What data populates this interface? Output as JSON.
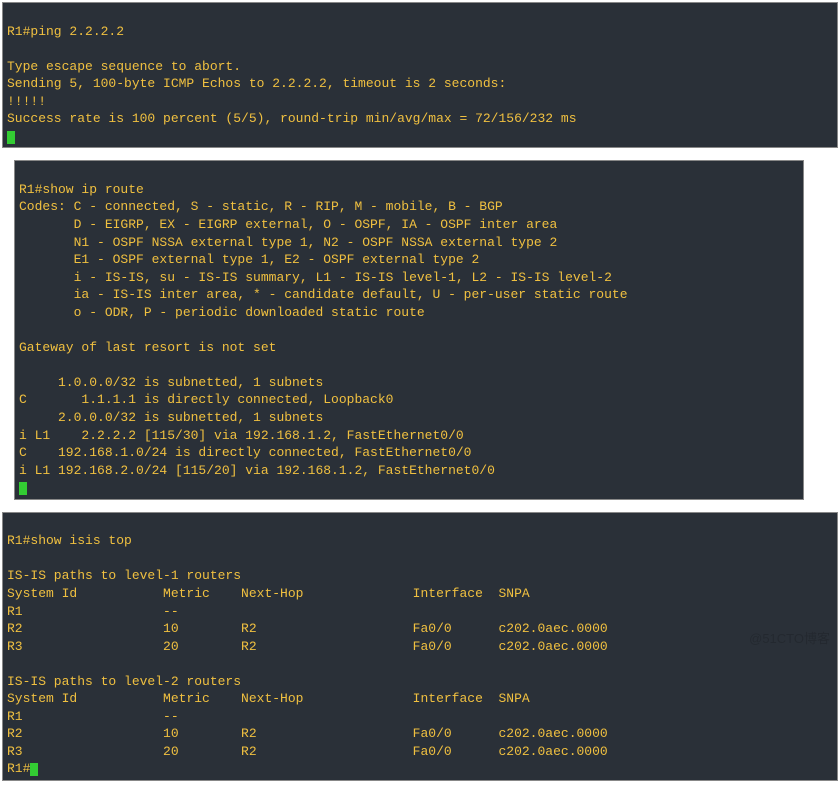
{
  "terminal1": {
    "cmd": "R1#ping 2.2.2.2",
    "lines": [
      "",
      "Type escape sequence to abort.",
      "Sending 5, 100-byte ICMP Echos to 2.2.2.2, timeout is 2 seconds:",
      "!!!!!",
      "Success rate is 100 percent (5/5), round-trip min/avg/max = 72/156/232 ms"
    ]
  },
  "terminal2": {
    "cmd": "R1#show ip route",
    "codes": [
      "Codes: C - connected, S - static, R - RIP, M - mobile, B - BGP",
      "       D - EIGRP, EX - EIGRP external, O - OSPF, IA - OSPF inter area ",
      "       N1 - OSPF NSSA external type 1, N2 - OSPF NSSA external type 2",
      "       E1 - OSPF external type 1, E2 - OSPF external type 2",
      "       i - IS-IS, su - IS-IS summary, L1 - IS-IS level-1, L2 - IS-IS level-2",
      "       ia - IS-IS inter area, * - candidate default, U - per-user static route",
      "       o - ODR, P - periodic downloaded static route"
    ],
    "gateway": "Gateway of last resort is not set",
    "routes": [
      "     1.0.0.0/32 is subnetted, 1 subnets",
      "C       1.1.1.1 is directly connected, Loopback0",
      "     2.0.0.0/32 is subnetted, 1 subnets",
      "i L1    2.2.2.2 [115/30] via 192.168.1.2, FastEthernet0/0",
      "C    192.168.1.0/24 is directly connected, FastEthernet0/0",
      "i L1 192.168.2.0/24 [115/20] via 192.168.1.2, FastEthernet0/0"
    ]
  },
  "terminal3": {
    "cmd": "R1#show isis top",
    "l1_header": "IS-IS paths to level-1 routers",
    "cols": {
      "sysid": "System Id",
      "metric": "Metric",
      "nexthop": "Next-Hop",
      "interface": "Interface",
      "snpa": "SNPA"
    },
    "l1_rows": [
      {
        "sysid": "R1",
        "metric": "--",
        "nexthop": "",
        "interface": "",
        "snpa": ""
      },
      {
        "sysid": "R2",
        "metric": "10",
        "nexthop": "R2",
        "interface": "Fa0/0",
        "snpa": "c202.0aec.0000"
      },
      {
        "sysid": "R3",
        "metric": "20",
        "nexthop": "R2",
        "interface": "Fa0/0",
        "snpa": "c202.0aec.0000"
      }
    ],
    "l2_header": "IS-IS paths to level-2 routers",
    "l2_rows": [
      {
        "sysid": "R1",
        "metric": "--",
        "nexthop": "",
        "interface": "",
        "snpa": ""
      },
      {
        "sysid": "R2",
        "metric": "10",
        "nexthop": "R2",
        "interface": "Fa0/0",
        "snpa": "c202.0aec.0000"
      },
      {
        "sysid": "R3",
        "metric": "20",
        "nexthop": "R2",
        "interface": "Fa0/0",
        "snpa": "c202.0aec.0000"
      }
    ],
    "prompt_end": "R1#"
  },
  "watermark": "@51CTO博客"
}
